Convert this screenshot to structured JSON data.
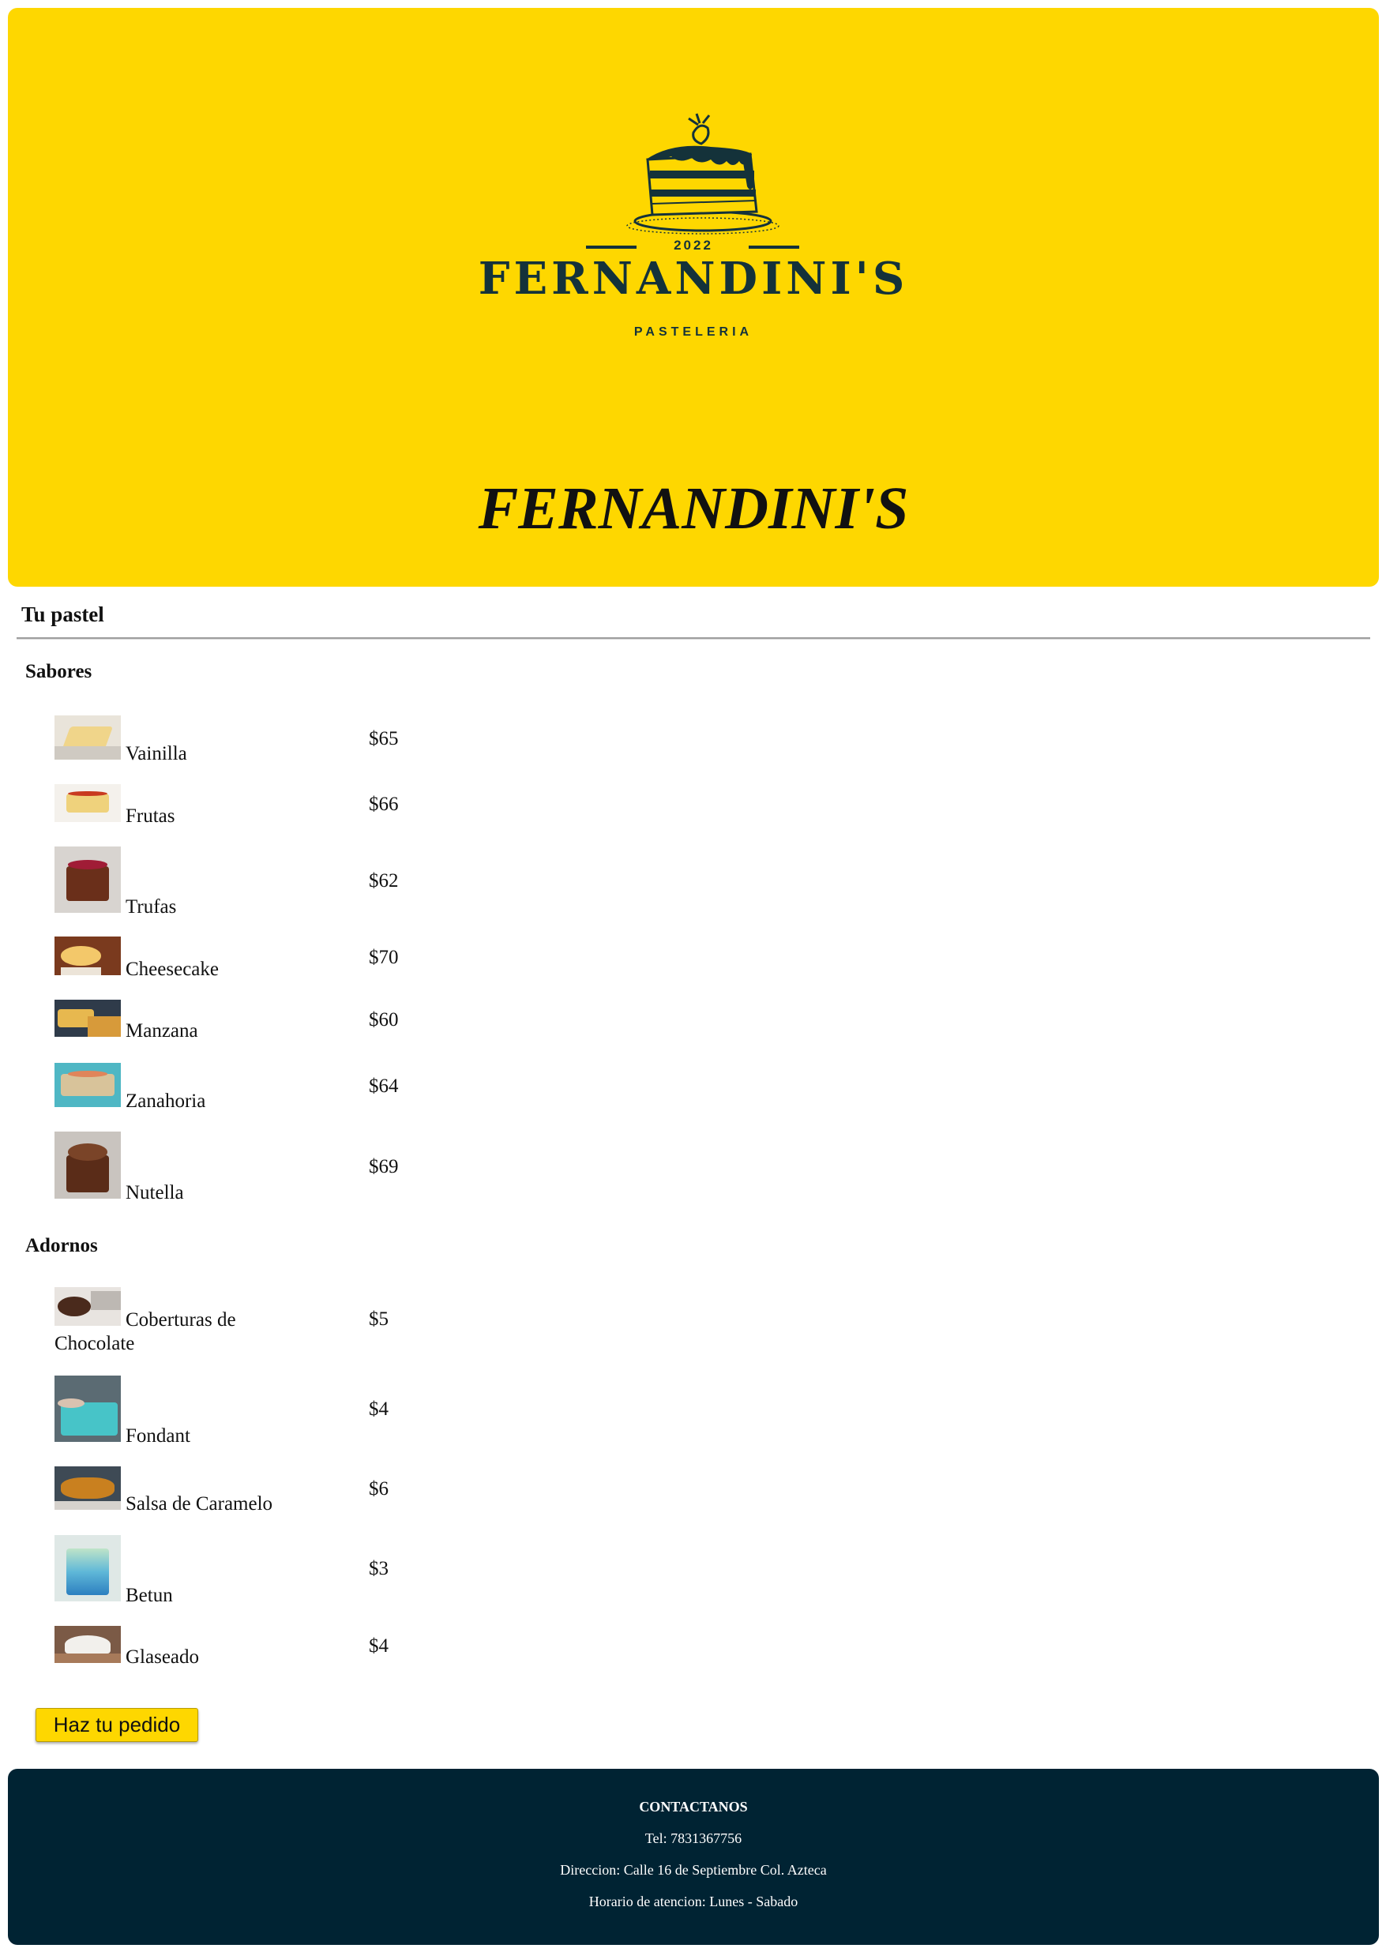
{
  "header": {
    "logo": {
      "year": "2022",
      "name": "FERNANDINI'S",
      "subtitle": "PASTELERIA"
    },
    "title": "FERNANDINI'S",
    "background": "#fed700"
  },
  "section": {
    "title": "Tu pastel"
  },
  "sabores": {
    "title": "Sabores",
    "items": [
      {
        "label": "Vainilla",
        "price": "$65",
        "icon": "vanilla-cake-photo"
      },
      {
        "label": "Frutas",
        "price": "$66",
        "icon": "fruit-cake-photo"
      },
      {
        "label": "Trufas",
        "price": "$62",
        "icon": "truffle-cake-photo"
      },
      {
        "label": "Cheesecake",
        "price": "$70",
        "icon": "cheesecake-photo"
      },
      {
        "label": "Manzana",
        "price": "$60",
        "icon": "apple-cake-photo"
      },
      {
        "label": "Zanahoria",
        "price": "$64",
        "icon": "carrot-cake-photo"
      },
      {
        "label": "Nutella",
        "price": "$69",
        "icon": "nutella-cake-photo"
      }
    ]
  },
  "adornos": {
    "title": "Adornos",
    "items": [
      {
        "label": "Coberturas de Chocolate",
        "price": "$5",
        "icon": "chocolate-coating-photo"
      },
      {
        "label": "Fondant",
        "price": "$4",
        "icon": "fondant-photo"
      },
      {
        "label": "Salsa de Caramelo",
        "price": "$6",
        "icon": "caramel-sauce-photo"
      },
      {
        "label": "Betun",
        "price": "$3",
        "icon": "frosting-photo"
      },
      {
        "label": "Glaseado",
        "price": "$4",
        "icon": "glaze-photo"
      }
    ]
  },
  "order_button": {
    "label": "Haz tu pedido"
  },
  "footer": {
    "title": "CONTACTANOS",
    "phone": "Tel: 7831367756",
    "address": "Direccion: Calle 16 de Septiembre Col. Azteca",
    "hours": "Horario de atencion: Lunes - Sabado",
    "background": "#002333"
  }
}
